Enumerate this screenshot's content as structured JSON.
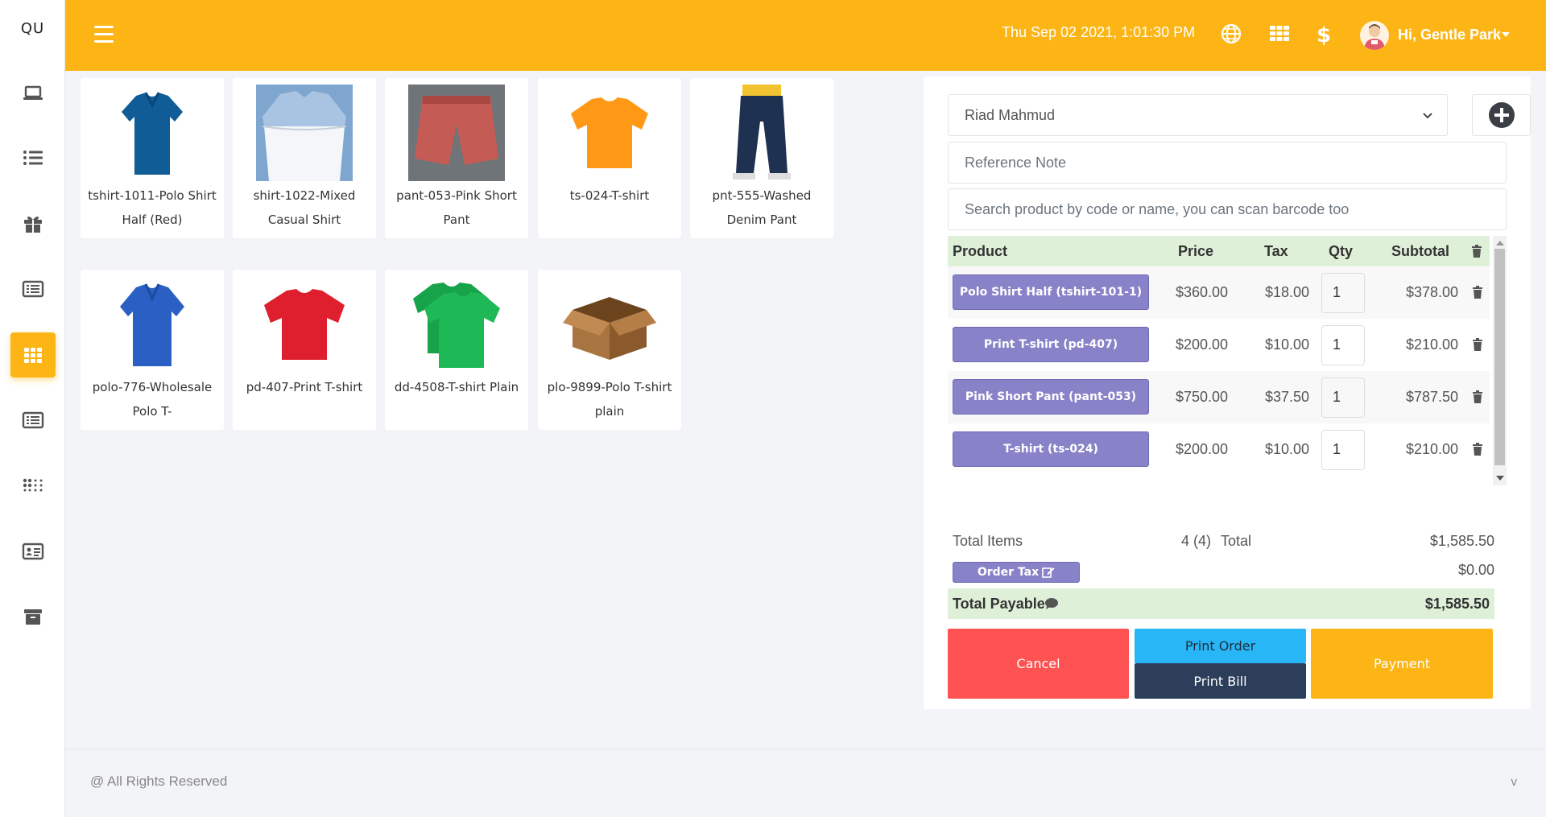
{
  "app": {
    "logo": "QU"
  },
  "colors": {
    "accent": "#fdb515",
    "product_button": "#8882c8",
    "cancel": "#ff5252",
    "print_order": "#29b6f6",
    "print_bill": "#2c3e5a",
    "payment": "#fdb515",
    "total_bg": "#dff0d8"
  },
  "sidebar": {
    "items": [
      {
        "icon": "laptop-icon"
      },
      {
        "icon": "list-icon"
      },
      {
        "icon": "gift-icon"
      },
      {
        "icon": "table-list-icon"
      },
      {
        "icon": "grid-icon",
        "active": true
      },
      {
        "icon": "table-list-icon"
      },
      {
        "icon": "dots-grid-icon"
      },
      {
        "icon": "id-card-icon"
      },
      {
        "icon": "archive-icon"
      }
    ]
  },
  "topbar": {
    "datetime": "Thu Sep 02 2021, 1:01:30 PM",
    "greeting": "Hi, Gentle Park",
    "icons": [
      "globe-icon",
      "grid-icon",
      "dollar-icon"
    ]
  },
  "products": [
    {
      "code_name": "tshirt-1011-Polo Shirt Half (Red)",
      "image": "navy-polo"
    },
    {
      "code_name": "shirt-1022-Mixed Casual Shirt",
      "image": "white-shirt"
    },
    {
      "code_name": "pant-053-Pink Short Pant",
      "image": "pink-shorts"
    },
    {
      "code_name": "ts-024-T-shirt",
      "image": "orange-tshirt"
    },
    {
      "code_name": "pnt-555-Washed Denim Pant",
      "image": "denim-pant"
    },
    {
      "code_name": "polo-776-Wholesale Polo T-",
      "image": "blue-polo"
    },
    {
      "code_name": "pd-407-Print T-shirt",
      "image": "red-tshirt"
    },
    {
      "code_name": "dd-4508-T-shirt Plain",
      "image": "green-tshirt"
    },
    {
      "code_name": "plo-9899-Polo T-shirt plain",
      "image": "box"
    }
  ],
  "pos": {
    "customer": "Riad Mahmud",
    "reference_placeholder": "Reference Note",
    "search_placeholder": "Search product by code or name, you can scan barcode too",
    "columns": {
      "product": "Product",
      "price": "Price",
      "tax": "Tax",
      "qty": "Qty",
      "subtotal": "Subtotal"
    },
    "rows": [
      {
        "product": "Polo Shirt Half (tshirt-101-1)",
        "price": "$360.00",
        "tax": "$18.00",
        "qty": "1",
        "subtotal": "$378.00"
      },
      {
        "product": "Print T-shirt (pd-407)",
        "price": "$200.00",
        "tax": "$10.00",
        "qty": "1",
        "subtotal": "$210.00"
      },
      {
        "product": "Pink Short Pant (pant-053)",
        "price": "$750.00",
        "tax": "$37.50",
        "qty": "1",
        "subtotal": "$787.50"
      },
      {
        "product": "T-shirt (ts-024)",
        "price": "$200.00",
        "tax": "$10.00",
        "qty": "1",
        "subtotal": "$210.00"
      }
    ],
    "total_items_label": "Total Items",
    "total_items_value": "4 (4)",
    "total_label": "Total",
    "total_value": "$1,585.50",
    "order_tax_label": "Order Tax",
    "order_tax_value": "$0.00",
    "payable_label": "Total Payable",
    "payable_value": "$1,585.50",
    "buttons": {
      "cancel": "Cancel",
      "print_order": "Print Order",
      "print_bill": "Print Bill",
      "payment": "Payment"
    }
  },
  "footer": {
    "copyright": "@ All Rights Reserved",
    "version": "v"
  }
}
